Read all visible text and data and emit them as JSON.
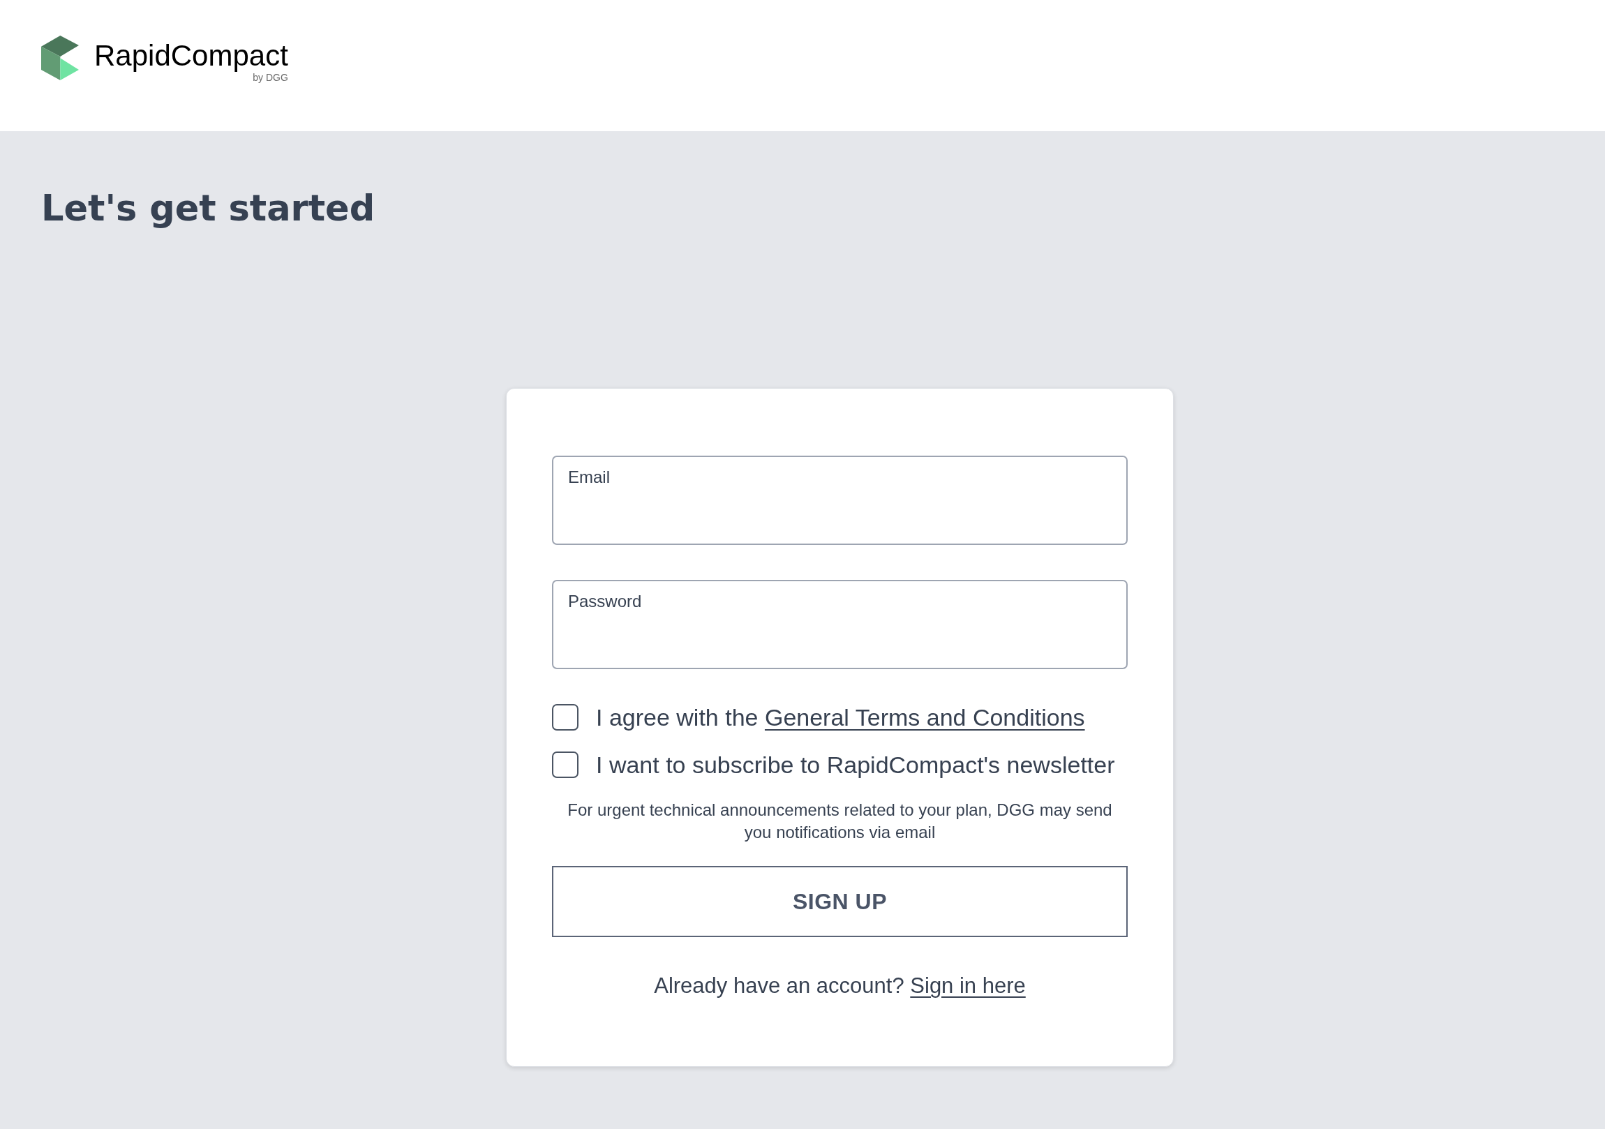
{
  "header": {
    "logo": {
      "name": "RapidCompact",
      "tagline": "by DGG"
    }
  },
  "page_title": "Let's get started",
  "signup_form": {
    "fields": [
      {
        "label": "Email"
      },
      {
        "label": "Password"
      }
    ],
    "checkboxes": [
      {
        "text": "I agree with the",
        "link": "General Terms and Conditions",
        "checked": false
      },
      {
        "text": "I want to subscribe to RapidCompact's newsletter",
        "checked": false
      }
    ],
    "note": "For urgent technical announcements related to your plan, DGG may send you notifications via email",
    "submit_button": "SIGN UP",
    "signin_prompt": {
      "text": "Already have an account?",
      "link": "Sign in here"
    }
  }
}
